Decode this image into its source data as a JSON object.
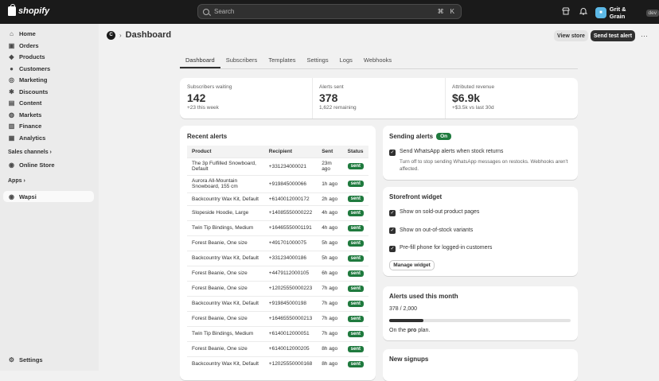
{
  "topbar": {
    "logo": "shopify",
    "search_placeholder": "Search",
    "shortcut_key1": "⌘",
    "shortcut_key2": "K",
    "store_name": "Grit & Grain",
    "store_badge": "dev",
    "icons": [
      "store-icon",
      "bell-icon"
    ]
  },
  "sidebar": {
    "items": [
      {
        "label": "Home",
        "icon": "home-icon"
      },
      {
        "label": "Orders",
        "icon": "orders-icon"
      },
      {
        "label": "Products",
        "icon": "tag-icon"
      },
      {
        "label": "Customers",
        "icon": "person-icon"
      },
      {
        "label": "Marketing",
        "icon": "target-icon"
      },
      {
        "label": "Discounts",
        "icon": "discount-icon"
      },
      {
        "label": "Content",
        "icon": "content-icon"
      },
      {
        "label": "Markets",
        "icon": "globe-icon"
      },
      {
        "label": "Finance",
        "icon": "bank-icon"
      },
      {
        "label": "Analytics",
        "icon": "chart-icon"
      }
    ],
    "sales_channels": "Sales channels",
    "online_store": "Online Store",
    "apps": "Apps",
    "wapsi": "Wapsi",
    "settings": "Settings"
  },
  "header": {
    "breadcrumb_sep": "›",
    "title": "Dashboard",
    "view_store": "View store",
    "send_test": "Send test alert",
    "more": "···"
  },
  "tabs": [
    "Dashboard",
    "Subscribers",
    "Templates",
    "Settings",
    "Logs",
    "Webhooks"
  ],
  "stats": [
    {
      "label": "Subscribers waiting",
      "value": "142",
      "sub": "+23 this week"
    },
    {
      "label": "Alerts sent",
      "value": "378",
      "sub": "1,622 remaining"
    },
    {
      "label": "Attributed revenue",
      "value": "$6.9k",
      "sub": "+$3.5k vs last 30d"
    }
  ],
  "recent": {
    "title": "Recent alerts",
    "columns": [
      "Product",
      "Recipient",
      "Sent",
      "Status"
    ],
    "rows": [
      [
        "The 3p Fulfilled Snowboard, Default",
        "+331234000021",
        "23m ago",
        "sent"
      ],
      [
        "Aurora All-Mountain Snowboard, 155 cm",
        "+919845000066",
        "1h ago",
        "sent"
      ],
      [
        "Backcountry Wax Kit, Default",
        "+6140012000172",
        "2h ago",
        "sent"
      ],
      [
        "Slopeside Hoodie, Large",
        "+14085550000222",
        "4h ago",
        "sent"
      ],
      [
        "Twin Tip Bindings, Medium",
        "+16465550001191",
        "4h ago",
        "sent"
      ],
      [
        "Forest Beanie, One size",
        "+491701000075",
        "5h ago",
        "sent"
      ],
      [
        "Backcountry Wax Kit, Default",
        "+331234000186",
        "5h ago",
        "sent"
      ],
      [
        "Forest Beanie, One size",
        "+4479112000105",
        "6h ago",
        "sent"
      ],
      [
        "Forest Beanie, One size",
        "+12025550000223",
        "7h ago",
        "sent"
      ],
      [
        "Backcountry Wax Kit, Default",
        "+919845000198",
        "7h ago",
        "sent"
      ],
      [
        "Forest Beanie, One size",
        "+16465550000213",
        "7h ago",
        "sent"
      ],
      [
        "Twin Tip Bindings, Medium",
        "+6140012000051",
        "7h ago",
        "sent"
      ],
      [
        "Forest Beanie, One size",
        "+6140012000205",
        "8h ago",
        "sent"
      ],
      [
        "Backcountry Wax Kit, Default",
        "+12025550000168",
        "8h ago",
        "sent"
      ]
    ]
  },
  "sending": {
    "title": "Sending alerts",
    "badge": "On",
    "option": "Send WhatsApp alerts when stock returns",
    "hint": "Turn off to stop sending WhatsApp messages on restocks. Webhooks aren't affected."
  },
  "widget": {
    "title": "Storefront widget",
    "options": [
      "Show on sold-out product pages",
      "Show on out-of-stock variants",
      "Pre-fill phone for logged-in customers"
    ],
    "manage": "Manage widget"
  },
  "usage": {
    "title": "Alerts used this month",
    "count": "378 / 2,000",
    "progress": 0.189,
    "plan_prefix": "On the",
    "plan_name": "pro",
    "plan_suffix": "plan."
  },
  "signups": {
    "title": "New signups"
  }
}
